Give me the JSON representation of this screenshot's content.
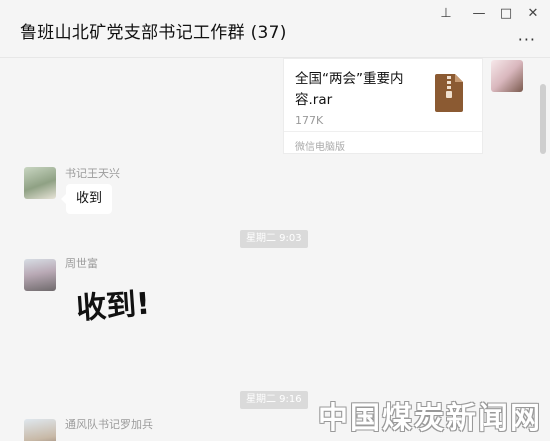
{
  "window": {
    "title": "鲁班山北矿党支部书记工作群 (37)",
    "controls": {
      "pin": "⊥",
      "minimize": "—",
      "maximize": "□",
      "close": "✕"
    },
    "more": "···"
  },
  "messages": {
    "file": {
      "name": "全国“两会”重要内容.rar",
      "size": "177K",
      "source": "微信电脑版",
      "icon": "zip-file-icon"
    },
    "msg1": {
      "sender": "书记王天兴",
      "text": "收到"
    },
    "time1": "星期二 9:03",
    "msg2": {
      "sender": "周世富",
      "sticker_text": "收到!"
    },
    "time2": "星期二 9:16",
    "msg3": {
      "sender": "通风队书记罗加兵"
    }
  },
  "watermark": "中国煤炭新闻网",
  "colors": {
    "background": "#f5f5f5",
    "bubble": "#ffffff",
    "zip_icon": "#8b5a32"
  }
}
